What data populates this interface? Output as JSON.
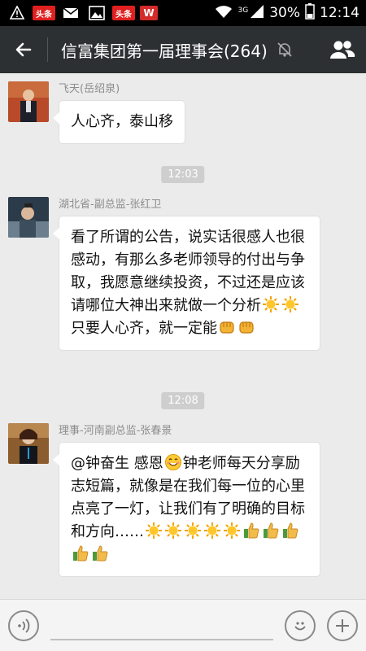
{
  "status_bar": {
    "badge_1": "头条",
    "badge_2": "头条",
    "wps": "W",
    "network": "3G",
    "battery": "30%",
    "time": "12:14"
  },
  "header": {
    "title": "信富集团第一届理事会(264)"
  },
  "messages": [
    {
      "sender": "飞天(岳绍泉)",
      "text": "人心齐，泰山移"
    },
    {
      "time": "12:03"
    },
    {
      "sender": "湖北省-副总监-张红卫",
      "text_1": "看了所谓的公告，说实话很感人也很感动，有那么多老师领导的付出与争取，我愿意继续投资，不过还是应该请哪位大神出来就做一个分析",
      "text_2": "只要人心齐，就一定能"
    },
    {
      "time": "12:08"
    },
    {
      "sender": "理事-河南副总监-张春景",
      "text_1": "@钟奋生 感恩",
      "text_2": "钟老师每天分享励志短篇，就像是在我们每一位的心里点亮了一灯，让我们有了明确的目标和方向……"
    }
  ],
  "input": {
    "placeholder": ""
  },
  "colors": {
    "header_bg": "#2d3033",
    "chat_bg": "#ebebeb",
    "bubble_bg": "#ffffff",
    "time_badge_bg": "#cecece"
  },
  "icons": [
    "back-arrow-icon",
    "mute-bell-icon",
    "group-members-icon",
    "voice-icon",
    "smiley-emoji-icon",
    "plus-icon",
    "sun-emoji-icon",
    "fist-emoji-icon",
    "thumbs-up-emoji-icon"
  ]
}
